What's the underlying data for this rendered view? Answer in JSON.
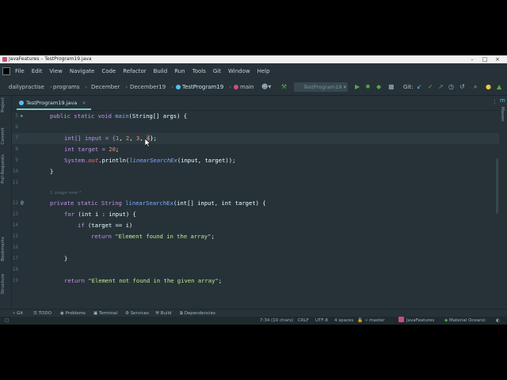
{
  "window": {
    "title": "JavaFeatures – TestProgram19.java"
  },
  "menu": [
    "File",
    "Edit",
    "View",
    "Navigate",
    "Code",
    "Refactor",
    "Build",
    "Run",
    "Tools",
    "Git",
    "Window",
    "Help"
  ],
  "nav": {
    "breadcrumbs": [
      "dailypractise",
      "programs",
      "December",
      "December19",
      "TestProgram19",
      "main"
    ],
    "run_config": "TestProgram19",
    "git_label": "Git:"
  },
  "left_tabs": [
    "Project",
    "Commit",
    "Pull Requests",
    "Bookmarks",
    "Structure"
  ],
  "right_tabs": [
    "Maven"
  ],
  "editor_tab": {
    "label": "TestProgram19.java",
    "close": "×"
  },
  "code": {
    "line5": {
      "num": "5",
      "parts": [
        "public static void ",
        "main",
        "(String[] args) {"
      ]
    },
    "line6": {
      "num": "6"
    },
    "line7": {
      "num": "7",
      "a": "int[] input = {",
      "n1": "1",
      "c1": ", ",
      "n2": "2",
      "c2": ", ",
      "n3": "3",
      "c3": ", ",
      "n4": "4",
      "end": "};"
    },
    "line8": {
      "num": "8",
      "a": "int target = ",
      "n": "20",
      "end": ";"
    },
    "line9": {
      "num": "9",
      "a": "System.",
      "out": "out",
      "b": ".println(",
      "call": "linearSearchEx",
      "c": "(input, target));"
    },
    "line10": {
      "num": "10",
      "text": "}"
    },
    "line11": {
      "num": "11"
    },
    "hint": "1 usage   new *",
    "line12": {
      "num": "12",
      "a": "private static ",
      "b": "String ",
      "name": "linearSearchEx",
      "c": "(int[] input, int target) {"
    },
    "line13": {
      "num": "13",
      "a": "for ",
      "b": "(int i : input) {"
    },
    "line14": {
      "num": "14",
      "a": "if ",
      "b": "(target == i)"
    },
    "line15": {
      "num": "15",
      "a": "return ",
      "s": "\"Element found in the array\"",
      "end": ";"
    },
    "line16": {
      "num": "16"
    },
    "line17": {
      "num": "17",
      "text": "}"
    },
    "line18": {
      "num": "18"
    },
    "line19": {
      "num": "19",
      "a": "return ",
      "s": "\"Element not found in the given array\"",
      "end": ";"
    }
  },
  "tool_windows": [
    "Git",
    "TODO",
    "Problems",
    "Terminal",
    "Services",
    "Build",
    "Dependencies"
  ],
  "status": {
    "position": "7:34 (10 chars)",
    "line_sep": "CRLF",
    "encoding": "UTF-8",
    "indent": "4 spaces",
    "branch": "master",
    "project": "JavaFeatures",
    "theme": "Material Oceanic"
  },
  "colors": {
    "editor_bg": "#263238",
    "keyword": "#c792ea",
    "function": "#82aaff",
    "string": "#c3e88d",
    "number": "#f78c6c",
    "accent": "#80cbc4"
  }
}
